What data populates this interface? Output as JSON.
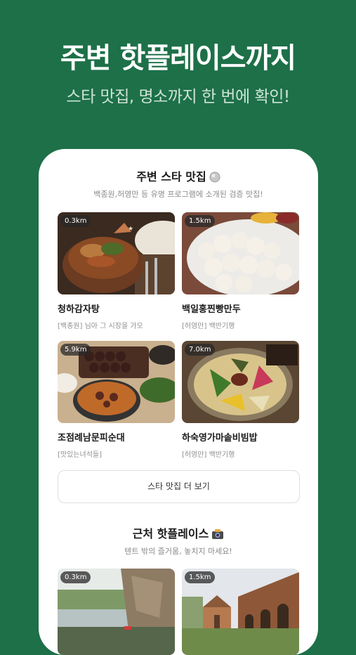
{
  "hero": {
    "title": "주변 핫플레이스까지",
    "subtitle": "스타 맛집, 명소까지 한 번에 확인!"
  },
  "star_section": {
    "title": "주변 스타 맛집",
    "icon": "star-badge-icon",
    "subtitle": "백종원,허영만 등 유명 프로그램에 소개된 검증 맛집!",
    "cards": [
      {
        "distance": "0.3km",
        "name": "청하감자탕",
        "desc": "[백종원] 님아 그 시장을 가오"
      },
      {
        "distance": "1.5km",
        "name": "백일홍찐빵만두",
        "desc": "[허영만] 백반기행"
      },
      {
        "distance": "5.9km",
        "name": "조점례남문피순대",
        "desc": "[맛있는녀석들]"
      },
      {
        "distance": "7.0km",
        "name": "하숙영가마솥비빔밥",
        "desc": "[허영만] 백반기행"
      }
    ],
    "more_label": "스타 맛집 더 보기"
  },
  "hot_section": {
    "title": "근처 핫플레이스",
    "icon": "camera-icon",
    "subtitle": "텐트 밖의 즐거움, 놓치지 마세요!",
    "cards": [
      {
        "distance": "0.3km"
      },
      {
        "distance": "1.5km"
      }
    ]
  },
  "colors": {
    "background": "#1d7048",
    "card": "#ffffff"
  }
}
